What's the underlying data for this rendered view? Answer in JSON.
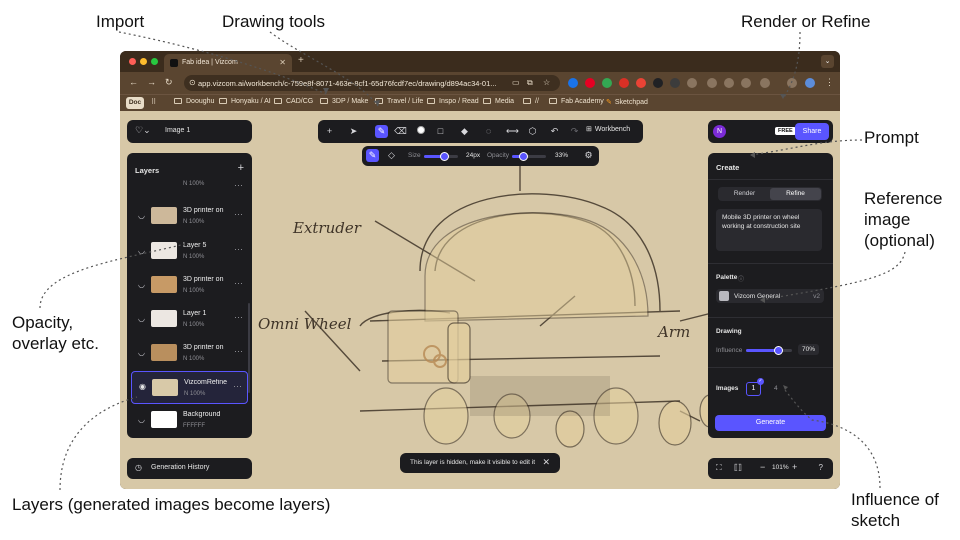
{
  "annotations": {
    "import": "Import",
    "drawing_tools": "Drawing tools",
    "render_or_refine": "Render or Refine",
    "prompt": "Prompt",
    "reference_image": "Reference\nimage\n(optional)",
    "opacity": "Opacity,\noverlay etc.",
    "layers": "Layers (generated images become layers)",
    "influence": "Influence of\nsketch"
  },
  "browser": {
    "tab_title": "Fab idea | Vizcom",
    "url": "app.vizcom.ai/workbench/c-759e8f-8071-463e-8cf1-65d76fcdf7ec/drawing/d894ac34-01...",
    "doc_badge": "Doc",
    "bookmarks": [
      "Dooughu",
      "Honyaku / AI",
      "CAD/CG",
      "3DP / Make",
      "Travel / Life",
      "Inspo / Read",
      "Media",
      "//",
      "Fab Academy",
      "Sketchpad"
    ]
  },
  "top_left": {
    "file_name": "Image 1"
  },
  "toolbar": {
    "workbench_label": "Workbench"
  },
  "subbar": {
    "size_label": "Size",
    "size_value": "24px",
    "size_level": 0.6,
    "opacity_label": "Opacity",
    "opacity_value": "33%",
    "opacity_level": 0.33
  },
  "layers": {
    "title": "Layers",
    "items": [
      {
        "name": "",
        "meta": "N 100%"
      },
      {
        "name": "3D printer on",
        "meta": "N 100%"
      },
      {
        "name": "Layer 5",
        "meta": "N 100%"
      },
      {
        "name": "3D printer on",
        "meta": "N 100%"
      },
      {
        "name": "Layer 1",
        "meta": "N 100%"
      },
      {
        "name": "3D printer on",
        "meta": "N 100%"
      },
      {
        "name": "VizcomRefine",
        "meta": "N 100%"
      },
      {
        "name": "Background",
        "meta": "FFFFFF"
      }
    ]
  },
  "generation_history": "Generation History",
  "toast": "This layer is hidden, make it visible to edit it",
  "top_right": {
    "avatar": "N",
    "plan_badge": "FREE",
    "share_label": "Share"
  },
  "create": {
    "title": "Create",
    "tabs": [
      "Render",
      "Refine"
    ],
    "active_tab": "Refine",
    "prompt": "Mobile 3D printer on wheel working at construction site",
    "palette_label": "Palette",
    "palette_name": "Vizcom General",
    "palette_version": "v2",
    "drawing_label": "Drawing",
    "influence_label": "Influence",
    "influence_value": "70%",
    "influence_level": 0.7,
    "images_label": "Images",
    "images_count": "1",
    "images_alt": "4",
    "generate_label": "Generate"
  },
  "zoom": {
    "value": "101%",
    "help": "?"
  },
  "sketch_labels": {
    "extruder": "Extruder",
    "omni_wheel": "Omni Wheel",
    "arm": "Arm"
  },
  "colors": {
    "accent": "#5a55ff",
    "panel": "#1c1c1f",
    "paper": "#d8c9a8",
    "browser": "#5a4530"
  }
}
